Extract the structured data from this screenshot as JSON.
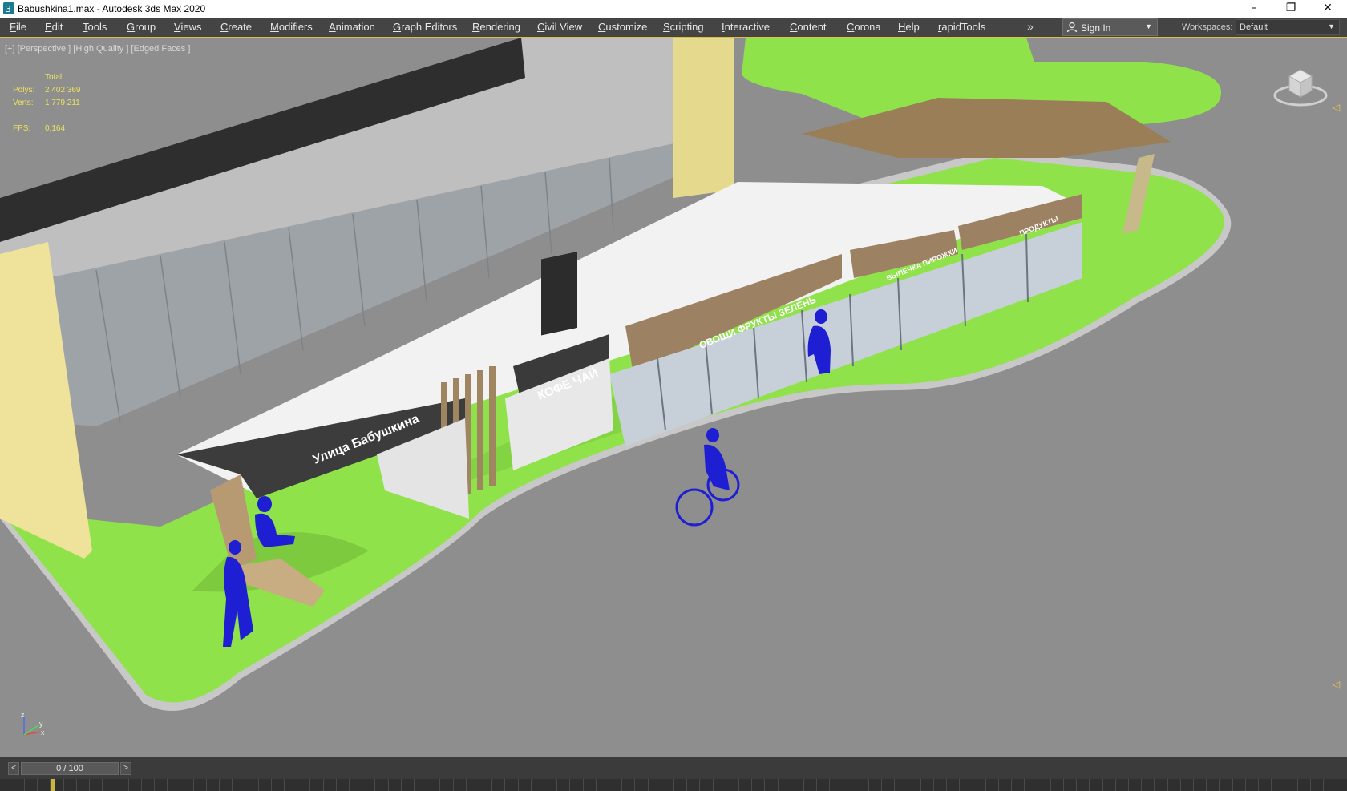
{
  "window": {
    "title": "Babushkina1.max - Autodesk 3ds Max 2020",
    "icon": "3ds-max-app-icon",
    "controls": [
      "minimize-icon",
      "restore-icon",
      "close-icon"
    ]
  },
  "menu": {
    "items": [
      "File",
      "Edit",
      "Tools",
      "Group",
      "Views",
      "Create",
      "Modifiers",
      "Animation",
      "Graph Editors",
      "Rendering",
      "Civil View",
      "Customize",
      "Scripting",
      "Interactive",
      "Content",
      "Corona",
      "Help",
      "rapidTools"
    ],
    "overflow_icon": "double-chevron-right-icon",
    "sign_in": "Sign In",
    "workspaces_label": "Workspaces:",
    "workspace_value": "Default"
  },
  "viewport": {
    "label": "[+] [Perspective ] [High Quality ] [Edged Faces ]",
    "stats": {
      "header": "Total",
      "polys_label": "Polys:",
      "polys": "2 402 369",
      "verts_label": "Verts:",
      "verts": "1 779 211",
      "fps_label": "FPS:",
      "fps": "0,164"
    },
    "signs": {
      "street": "Улица Бабушкина",
      "coffee": "КОФЕ ЧАЙ",
      "produce": "ОВОЩИ ФРУКТЫ ЗЕЛЕНЬ",
      "bakery": "ВЫПЕЧКА ПИРОЖКИ",
      "groceries": "ПРОДУКТЫ"
    },
    "axes": {
      "x": "x",
      "y": "y",
      "z": "z"
    },
    "colors": {
      "grass": "#8fe24a",
      "road": "#8c8c8c",
      "wood": "#9c8262",
      "people": "#1e1ed2"
    }
  },
  "timeline": {
    "prev": "<",
    "next": ">",
    "frame": "0 / 100"
  }
}
